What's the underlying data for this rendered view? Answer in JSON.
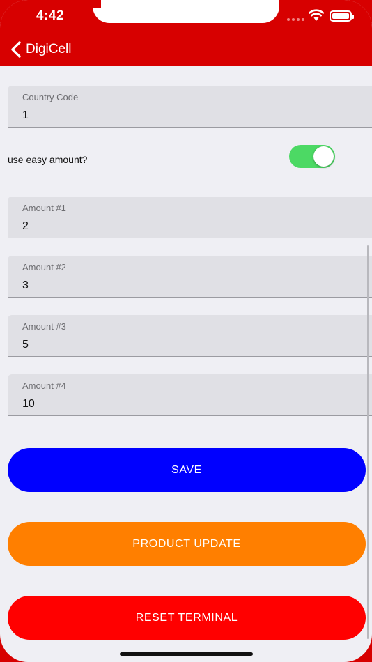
{
  "status_bar": {
    "time": "4:42"
  },
  "nav": {
    "back_label": "DigiCell"
  },
  "fields": [
    {
      "label": "Country Code",
      "value": "1"
    },
    {
      "label": "Amount #1",
      "value": "2"
    },
    {
      "label": "Amount #2",
      "value": "3"
    },
    {
      "label": "Amount #3",
      "value": "5"
    },
    {
      "label": "Amount #4",
      "value": "10"
    }
  ],
  "easy_amount": {
    "label": "use easy amount?",
    "enabled": true
  },
  "buttons": {
    "save": "SAVE",
    "product_update": "PRODUCT UPDATE",
    "reset_terminal": "RESET TERMINAL"
  },
  "colors": {
    "header": "#d70000",
    "save": "#0000ff",
    "product_update": "#ff7f00",
    "reset_terminal": "#ff0000",
    "toggle_on": "#4cd964"
  }
}
